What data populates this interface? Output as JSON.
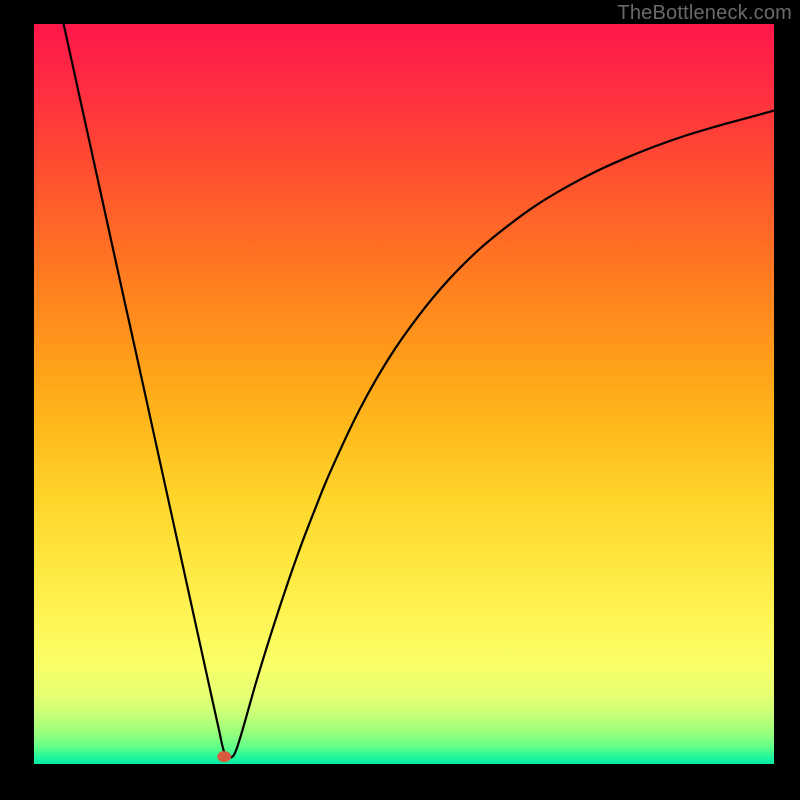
{
  "watermark": "TheBottleneck.com",
  "chart_data": {
    "type": "line",
    "title": "",
    "xlabel": "",
    "ylabel": "",
    "xlim": [
      0,
      100
    ],
    "ylim": [
      0,
      100
    ],
    "grid": false,
    "legend": false,
    "gradient_stops": [
      {
        "offset": 0.0,
        "color": "#ff174a"
      },
      {
        "offset": 0.08,
        "color": "#ff2b42"
      },
      {
        "offset": 0.16,
        "color": "#ff4335"
      },
      {
        "offset": 0.24,
        "color": "#ff5c2b"
      },
      {
        "offset": 0.32,
        "color": "#ff7522"
      },
      {
        "offset": 0.4,
        "color": "#ff8d1c"
      },
      {
        "offset": 0.48,
        "color": "#ffa61a"
      },
      {
        "offset": 0.56,
        "color": "#ffbe1d"
      },
      {
        "offset": 0.64,
        "color": "#ffd52a"
      },
      {
        "offset": 0.72,
        "color": "#ffe53d"
      },
      {
        "offset": 0.8,
        "color": "#fff454"
      },
      {
        "offset": 0.86,
        "color": "#faff66"
      },
      {
        "offset": 0.905,
        "color": "#e8ff72"
      },
      {
        "offset": 0.935,
        "color": "#c6ff78"
      },
      {
        "offset": 0.96,
        "color": "#93ff7d"
      },
      {
        "offset": 0.978,
        "color": "#5cff87"
      },
      {
        "offset": 0.99,
        "color": "#24f79a"
      },
      {
        "offset": 1.0,
        "color": "#07eaa7"
      }
    ],
    "minimum_marker": {
      "x": 25.7,
      "y": 1.0,
      "color": "#d85a3f",
      "r": 1.0
    },
    "series": [
      {
        "name": "bottleneck-curve",
        "x": [
          4,
          6,
          8,
          10,
          12,
          14,
          16,
          18,
          20,
          22,
          24,
          25,
          25.5,
          26,
          27,
          28,
          30,
          32,
          34,
          36,
          38,
          40,
          44,
          48,
          52,
          56,
          60,
          64,
          68,
          72,
          76,
          80,
          84,
          88,
          92,
          96,
          100
        ],
        "y": [
          100,
          90.9,
          81.8,
          72.7,
          63.6,
          54.6,
          45.5,
          36.4,
          27.3,
          18.2,
          9.1,
          4.6,
          2.3,
          1.0,
          1.2,
          4.0,
          11.0,
          17.5,
          23.6,
          29.3,
          34.5,
          39.4,
          47.9,
          54.9,
          60.6,
          65.4,
          69.4,
          72.7,
          75.6,
          78.0,
          80.1,
          81.9,
          83.5,
          84.9,
          86.1,
          87.2,
          88.3
        ]
      }
    ]
  }
}
